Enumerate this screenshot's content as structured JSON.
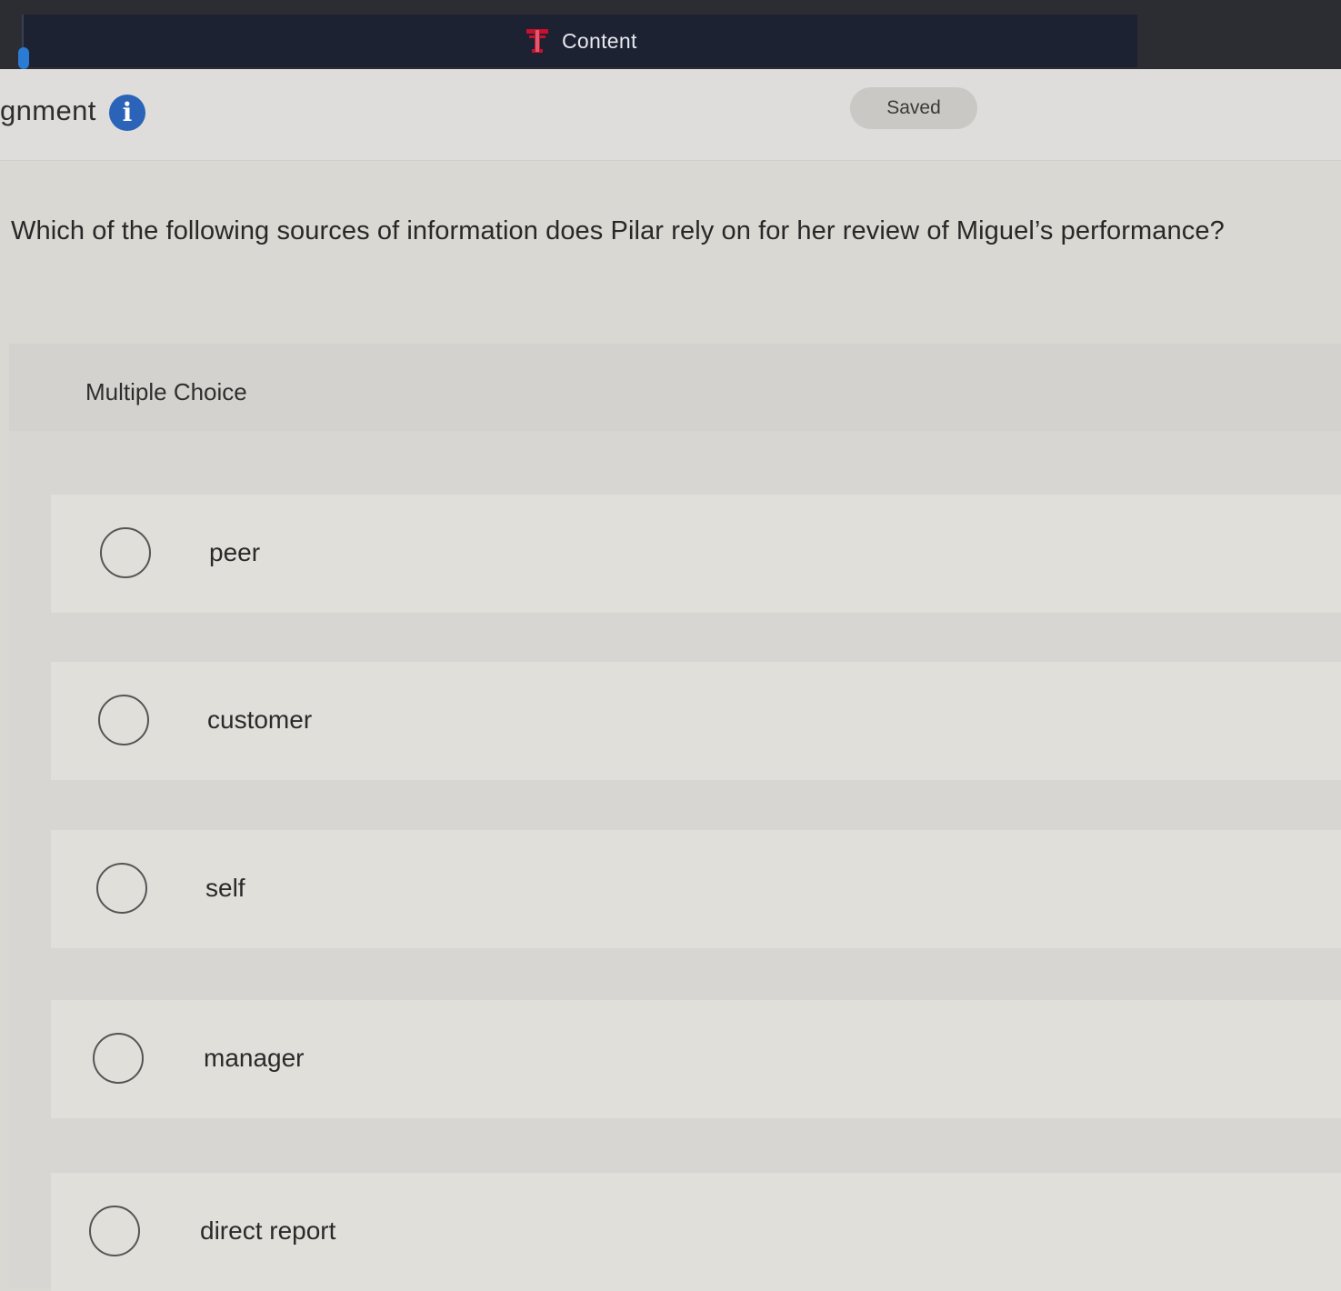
{
  "topbar": {
    "brand_label": "Content",
    "logo_icon": "texas-tech-logo-icon"
  },
  "header": {
    "title": "gnment",
    "info_icon_glyph": "i",
    "status": "Saved"
  },
  "question": {
    "text": "Which of the following sources of information does Pilar rely on for her review of Miguel’s performance?"
  },
  "choices": {
    "type_label": "Multiple Choice",
    "options": [
      {
        "label": "peer"
      },
      {
        "label": "customer"
      },
      {
        "label": "self"
      },
      {
        "label": "manager"
      },
      {
        "label": "direct report"
      }
    ]
  },
  "colors": {
    "topbar_bg": "#1d2233",
    "info_icon_bg": "#2a63b8",
    "logo_red": "#c8102e"
  }
}
